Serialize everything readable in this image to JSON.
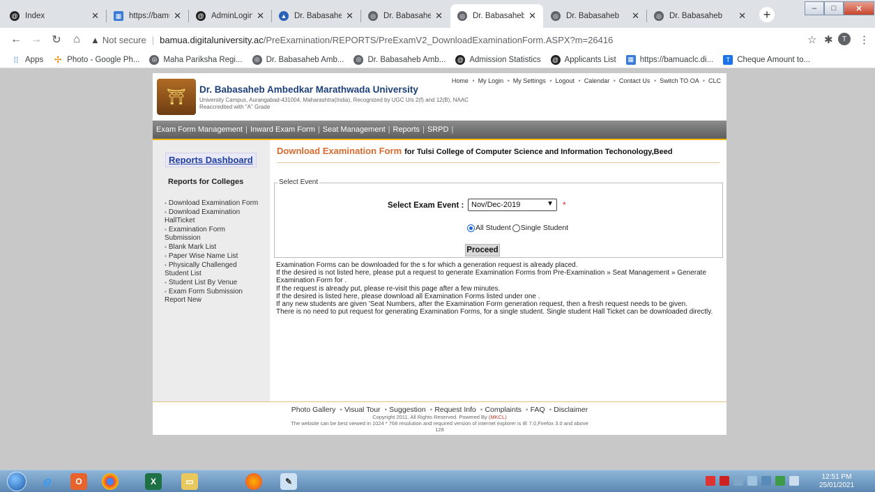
{
  "browser": {
    "tabs": [
      {
        "label": "Index",
        "icon": "admission-icon"
      },
      {
        "label": "https://bamuac",
        "icon": "site-icon"
      },
      {
        "label": "AdminLogin",
        "icon": "admission-icon"
      },
      {
        "label": "Dr. Babasaheb",
        "icon": "graduation-icon"
      },
      {
        "label": "Dr. Babasaheb",
        "icon": "globe-icon"
      },
      {
        "label": "Dr. Babasaheb",
        "icon": "globe-icon"
      },
      {
        "label": "Dr. Babasaheb",
        "icon": "globe-icon"
      },
      {
        "label": "Dr. Babasaheb",
        "icon": "globe-icon"
      }
    ],
    "active_tab": 5,
    "address": {
      "security": "Not secure",
      "host": "bamua.digitaluniversity.ac",
      "path": "/PreExamination/REPORTS/PreExamV2_DownloadExaminationForm.ASPX?m=26416"
    },
    "profile_initial": "T",
    "bookmarks": [
      {
        "label": "Apps",
        "icon": "apps-grid-icon"
      },
      {
        "label": "Photo - Google Ph...",
        "icon": "pinwheel-icon"
      },
      {
        "label": "Maha Pariksha Regi...",
        "icon": "globe-icon"
      },
      {
        "label": "Dr. Babasaheb Amb...",
        "icon": "globe-icon"
      },
      {
        "label": "Dr. Babasaheb Amb...",
        "icon": "globe-icon"
      },
      {
        "label": "Admission Statistics",
        "icon": "admission-icon"
      },
      {
        "label": "Applicants List",
        "icon": "admission-icon"
      },
      {
        "label": "https://bamuaclc.di...",
        "icon": "site-icon"
      },
      {
        "label": "Cheque Amount to...",
        "icon": "t-icon"
      }
    ]
  },
  "site": {
    "top_links": [
      "Home",
      "My Login",
      "My Settings",
      "Logout",
      "Calendar",
      "Contact Us",
      "Switch TO OA",
      "CLC"
    ],
    "university_name": "Dr. Babasaheb Ambedkar Marathwada University",
    "university_sub1": "University Campus, Aurangabad-431004, Maharashtra(India), Recognized by UGC U/s 2(f) and 12(B), NAAC",
    "university_sub2": "Reaccredited with \"A\" Grade",
    "menu": [
      "Exam Form Management",
      "Inward Exam Form",
      "Seat Management",
      "Reports",
      "SRPD"
    ]
  },
  "sidebar": {
    "dashboard_title": "Reports Dashboard",
    "section_title": "Reports for Colleges",
    "links": [
      "Download Examination Form",
      "Download Examination HallTicket",
      "Examination Form Submission",
      "Blank Mark List",
      "Paper Wise Name List",
      "Physically Challenged Student List",
      "Student List By Venue",
      "Exam Form Submission Report New"
    ]
  },
  "main": {
    "title": "Download Examination Form",
    "college": "for Tulsi College of Computer Science and Information Techonology,Beed",
    "legend": "Select Event",
    "select_label": "Select Exam Event :",
    "select_value": "Nov/Dec-2019",
    "required_mark": "*",
    "radio_all": "All Student",
    "radio_single": "Single Student",
    "radio_selected": "all",
    "proceed_label": "Proceed",
    "notes": [
      "Examination Forms can be downloaded for the s for which a generation request is already placed.",
      "If the desired  is not listed here, please put a request to generate Examination Forms from Pre-Examination » Seat Management » Generate Examination Form for .",
      "If the request is already put, please re-visit this page after a few minutes.",
      "If the desired is listed here, please download all Examination Forms listed under one .",
      "If any new students are given 'Seat Numbers, after the Examination Form generation request, then a fresh request needs to be given.",
      "There is no need to put request for generating Examination Forms, for a single student. Single student Hall Ticket can be downloaded directly."
    ]
  },
  "footer": {
    "links": [
      "Photo Gallery",
      "Visual Tour",
      "Suggestion",
      "Request Info",
      "Complaints",
      "FAQ",
      "Disclaimer"
    ],
    "copyright": "Copyright 2011. All Rights Reserved. Powered By",
    "powered_by": "(MKCL)",
    "resolution_note": "The website can be best viewed in 1024 * 768 resolution and required version of internet explorer is IE 7.0,Firefox 3.0 and above",
    "counter": "128"
  },
  "taskbar": {
    "time": "12:51 PM",
    "date": "25/01/2021"
  },
  "colors": {
    "accent_orange": "#d86a2e",
    "uni_blue": "#1d3f7c",
    "menu_gray": "#6e6e6e"
  }
}
